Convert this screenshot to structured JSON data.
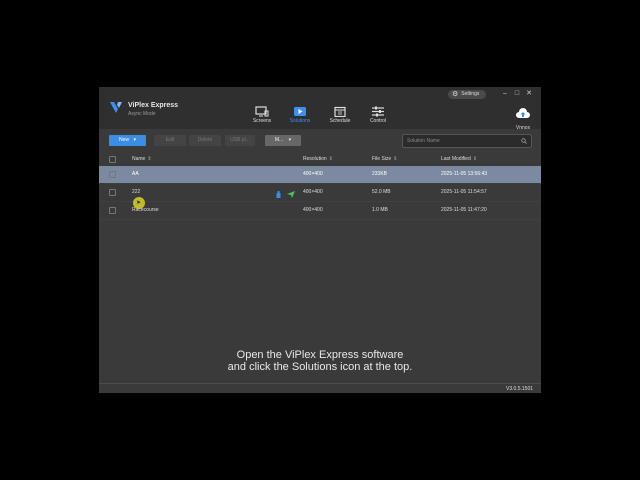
{
  "app": {
    "name": "ViPlex Express",
    "mode": "Async Mode",
    "settings_label": "Settings",
    "window_controls": [
      "minimize",
      "maximize",
      "close"
    ]
  },
  "nav": {
    "items": [
      {
        "label": "Screens",
        "icon": "monitor-icon",
        "active": false
      },
      {
        "label": "Solutions",
        "icon": "play-icon",
        "active": true
      },
      {
        "label": "Schedule",
        "icon": "calendar-icon",
        "active": false
      },
      {
        "label": "Control",
        "icon": "sliders-icon",
        "active": false
      }
    ],
    "vnnox_label": "Vnnox"
  },
  "toolbar": {
    "new_label": "New",
    "edit_label": "Edit",
    "delete_label": "Delete",
    "usb_label": "USB pl...",
    "more_label": "M..."
  },
  "search": {
    "placeholder": "Solution Name"
  },
  "table": {
    "headers": [
      "Name",
      "Resolution",
      "File Size",
      "Last Modified"
    ],
    "rows": [
      {
        "name": "AA",
        "resolution": "400×400",
        "size": "233KB",
        "modified": "2025-11-05 13:56:43",
        "selected": true
      },
      {
        "name": "222",
        "resolution": "400×400",
        "size": "52.0 MB",
        "modified": "2025-11-05 11:54:57",
        "selected": false
      },
      {
        "name": "Racecourse",
        "resolution": "400×400",
        "size": "1.0 MB",
        "modified": "2025-11-05 11:47:20",
        "selected": false
      }
    ]
  },
  "caption": {
    "line1": "Open the ViPlex Express software",
    "line2": "and click the Solutions icon at the top."
  },
  "version": "V3.0.5.1501",
  "colors": {
    "accent": "#3a8ee6",
    "selected_row": "#7b8aa0",
    "background": "#3a3a3a"
  }
}
